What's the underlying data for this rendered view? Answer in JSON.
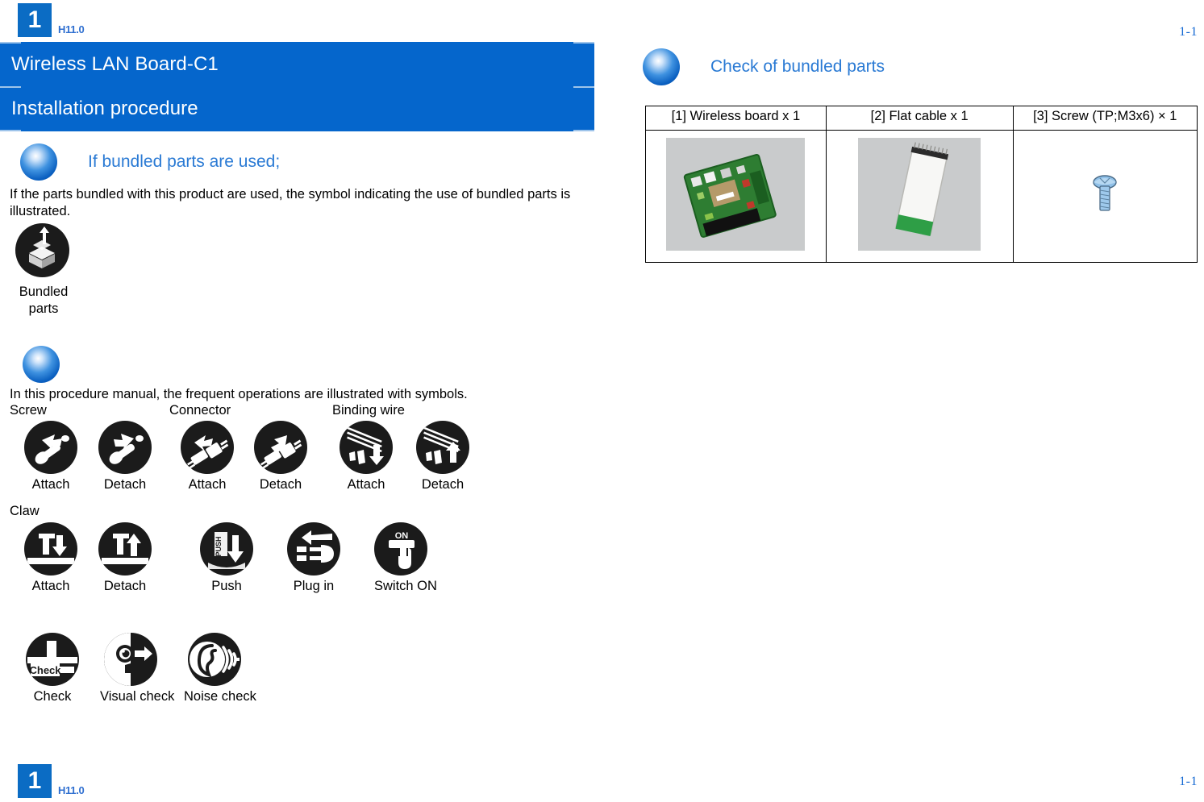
{
  "document": {
    "chapter_number": "1",
    "version_label": "H11.0",
    "page_number": "1-1"
  },
  "title_block": {
    "product_title": "Wireless LAN Board-C1",
    "section_title": "Installation procedure"
  },
  "bundled_section": {
    "heading": "If bundled parts are used;",
    "paragraph": "If the parts bundled with this product are used, the symbol indicating the use of bundled parts is illustrated.",
    "symbol_caption_line1": "Bundled",
    "symbol_caption_line2": "parts",
    "symbol_icon": "bundled-parts-icon"
  },
  "symbols_section": {
    "paragraph": "In this procedure manual, the frequent operations are illustrated with symbols.",
    "groups": [
      {
        "label": "Screw"
      },
      {
        "label": "Connector"
      },
      {
        "label": "Binding wire"
      },
      {
        "label": "Claw"
      }
    ],
    "row1": [
      {
        "caption": "Attach",
        "icon": "screw-attach-icon"
      },
      {
        "caption": "Detach",
        "icon": "screw-detach-icon"
      },
      {
        "caption": "Attach",
        "icon": "connector-attach-icon"
      },
      {
        "caption": "Detach",
        "icon": "connector-detach-icon"
      },
      {
        "caption": "Attach",
        "icon": "binding-wire-attach-icon"
      },
      {
        "caption": "Detach",
        "icon": "binding-wire-detach-icon"
      }
    ],
    "row2": [
      {
        "caption": "Attach",
        "icon": "claw-attach-icon"
      },
      {
        "caption": "Detach",
        "icon": "claw-detach-icon"
      },
      {
        "caption": "Push",
        "icon": "push-icon"
      },
      {
        "caption": "Plug in",
        "icon": "plug-in-icon"
      },
      {
        "caption": "Switch ON",
        "icon": "switch-on-icon"
      }
    ],
    "row3": [
      {
        "caption": "Check",
        "icon": "check-icon"
      },
      {
        "caption": "Visual check",
        "icon": "visual-check-icon"
      },
      {
        "caption": "Noise check",
        "icon": "noise-check-icon"
      }
    ],
    "icon_inner_labels": {
      "push": "PUSH",
      "switch_on": "ON",
      "check": "Check"
    }
  },
  "bundled_parts_check": {
    "heading": "Check of bundled parts",
    "table": {
      "headers": [
        "[1] Wireless board x 1",
        "[2] Flat cable x 1",
        "[3] Screw (TP;M3x6) × 1"
      ],
      "cells": [
        {
          "image": "wireless-board-photo"
        },
        {
          "image": "flat-cable-photo"
        },
        {
          "image": "screw-illustration"
        }
      ]
    }
  },
  "colors": {
    "header_blue": "#0566CC",
    "link_blue": "#2A7AD4",
    "logo_blue": "#0B6CC4",
    "page_no_blue": "#1569D3",
    "symbol_black": "#1B1B1B"
  }
}
